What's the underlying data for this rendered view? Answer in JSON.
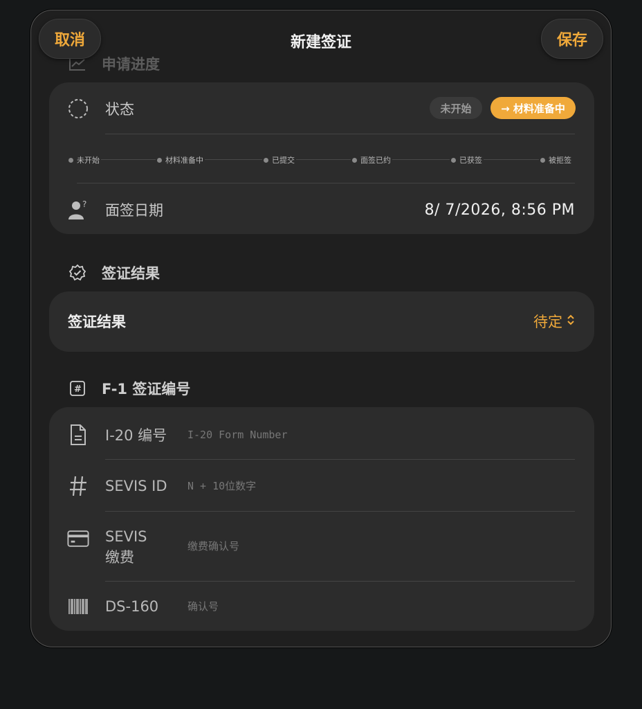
{
  "header": {
    "title": "新建签证",
    "cancel_label": "取消",
    "save_label": "保存"
  },
  "progress_section": {
    "title": "申请进度",
    "status_label": "状态",
    "chips": [
      "未开始",
      "→ 材料准备中"
    ],
    "steps": [
      "未开始",
      "材料准备中",
      "已提交",
      "面签已约",
      "已获签",
      "被拒签"
    ],
    "interview_date_label": "面签日期",
    "interview_date_value": "8/  7/2026,   8:56 PM"
  },
  "result_section": {
    "title": "签证结果",
    "result_label": "签证结果",
    "result_value": "待定",
    "result_chevron": "⌃⌄"
  },
  "f1_section": {
    "title": "F-1 签证编号",
    "fields": [
      {
        "label": "I-20 编号",
        "placeholder": "I-20 Form Number",
        "icon": "document-icon"
      },
      {
        "label": "SEVIS ID",
        "placeholder": "N + 10位数字",
        "icon": "hash-icon"
      },
      {
        "label": "SEVIS\n缴费",
        "placeholder": "缴费确认号",
        "icon": "credit-card-icon"
      },
      {
        "label": "DS-160",
        "placeholder": "确认号",
        "icon": "barcode-icon"
      }
    ]
  },
  "colors": {
    "accent": "#f0a93a",
    "background": "#1f1f1f",
    "card": "#2c2c2c"
  }
}
